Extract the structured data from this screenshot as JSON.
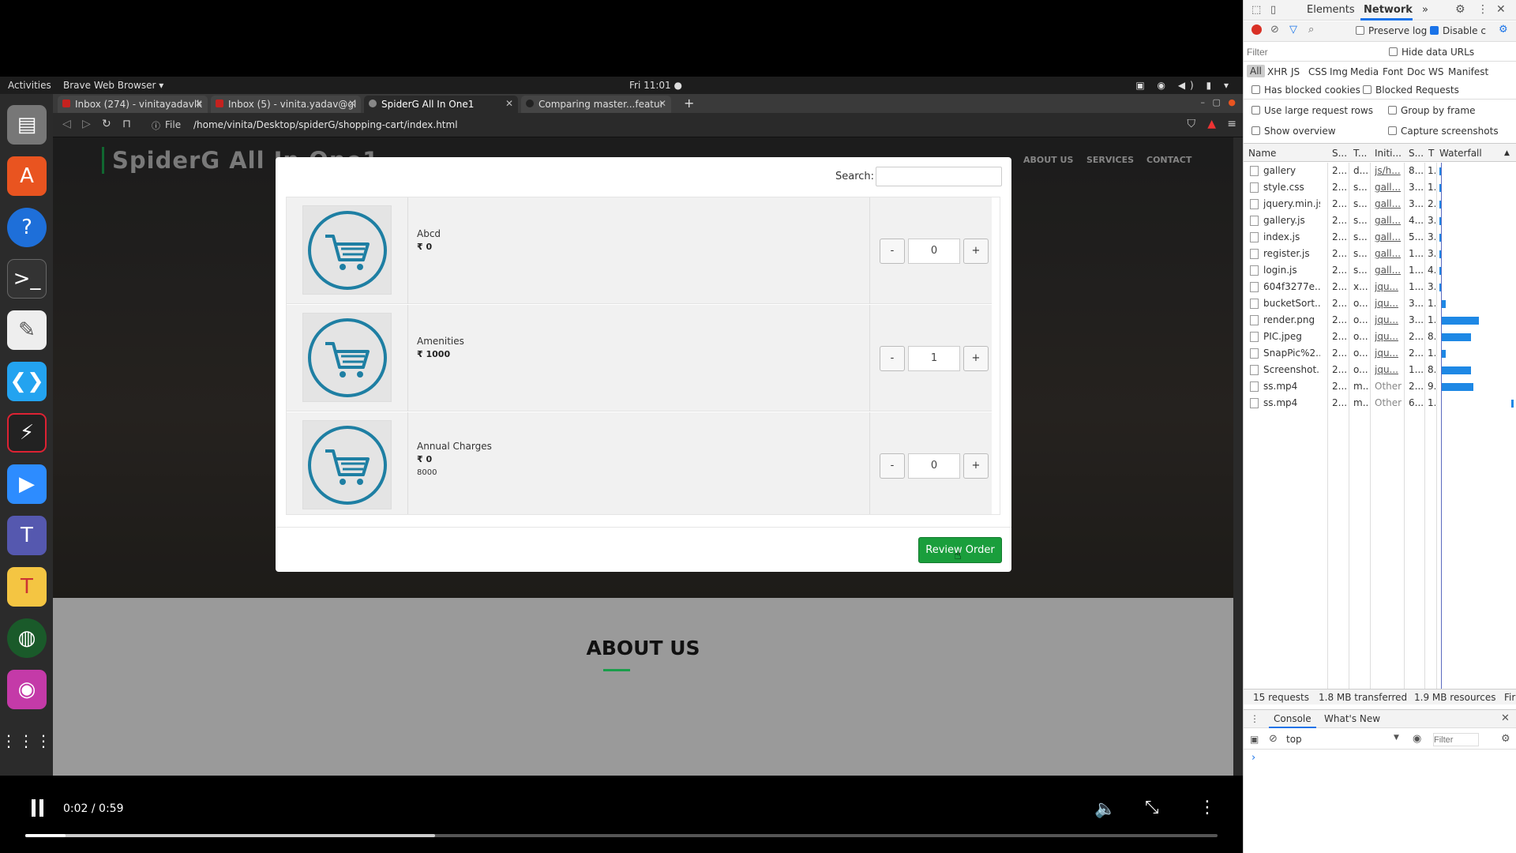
{
  "topbar": {
    "activities": "Activities",
    "app_menu": "Brave Web Browser ▾",
    "clock": "Fri 11:01 ●"
  },
  "browser": {
    "tabs": [
      {
        "label": "Inbox (274) - vinitayadavlk",
        "color": "#c5221f"
      },
      {
        "label": "Inbox (5) - vinita.yadav@gl",
        "color": "#c5221f"
      },
      {
        "label": "SpiderG All In One1",
        "color": "#888888"
      },
      {
        "label": "Comparing master...featur",
        "color": "#222222"
      }
    ],
    "new_tab": "+",
    "file_label": "File",
    "url": "/home/vinita/Desktop/spiderG/shopping-cart/index.html"
  },
  "site": {
    "logo": "SpiderG All In One1",
    "nav": [
      "ABOUT US",
      "SERVICES",
      "CONTACT"
    ],
    "about_title": "ABOUT US",
    "scroll_top": "^"
  },
  "modal": {
    "search_label": "Search:",
    "search_value": "",
    "currency": "₹",
    "items": [
      {
        "name": "Abcd",
        "price": "₹ 0",
        "extra": "",
        "qty": "0"
      },
      {
        "name": "Amenities",
        "price": "₹ 1000",
        "extra": "",
        "qty": "1"
      },
      {
        "name": "Annual Charges",
        "price": "₹ 0",
        "extra": "8000",
        "qty": "0"
      }
    ],
    "minus": "-",
    "plus": "+",
    "review_button": "Review Order"
  },
  "video": {
    "time": "0:02 / 0:59",
    "progress_fraction": 0.034,
    "buffered_fraction": 0.344
  },
  "devtools": {
    "tabs": [
      "Elements",
      "Network",
      "»"
    ],
    "active_tab": "Network",
    "preserve_log": "Preserve log",
    "disable_cache": "Disable c",
    "filter_placeholder": "Filter",
    "hide_data_urls": "Hide data URLs",
    "filter_types": [
      "All",
      "XHR",
      "JS",
      "CSS",
      "Img",
      "Media",
      "Font",
      "Doc",
      "WS",
      "Manifest"
    ],
    "has_blocked_cookies": "Has blocked cookies",
    "blocked_requests": "Blocked Requests",
    "use_large_rows": "Use large request rows",
    "group_by_frame": "Group by frame",
    "show_overview": "Show overview",
    "capture_screenshots": "Capture screenshots",
    "columns": [
      "Name",
      "S...",
      "T...",
      "Initi...",
      "S...",
      "T",
      "Waterfall"
    ],
    "rows": [
      {
        "name": "gallery",
        "s": "2...",
        "t": "d...",
        "init": "js/h...",
        "size": "8...",
        "time": "1.",
        "bar_start": 0.0,
        "bar_len": 0.02
      },
      {
        "name": "style.css",
        "s": "2...",
        "t": "s...",
        "init": "gall...",
        "size": "3...",
        "time": "1.",
        "bar_start": 0.0,
        "bar_len": 0.02
      },
      {
        "name": "jquery.min.js",
        "s": "2...",
        "t": "s...",
        "init": "gall...",
        "size": "3...",
        "time": "2.",
        "bar_start": 0.0,
        "bar_len": 0.02
      },
      {
        "name": "gallery.js",
        "s": "2...",
        "t": "s...",
        "init": "gall...",
        "size": "4...",
        "time": "3.",
        "bar_start": 0.0,
        "bar_len": 0.02
      },
      {
        "name": "index.js",
        "s": "2...",
        "t": "s...",
        "init": "gall...",
        "size": "5...",
        "time": "3.",
        "bar_start": 0.0,
        "bar_len": 0.02
      },
      {
        "name": "register.js",
        "s": "2...",
        "t": "s...",
        "init": "gall...",
        "size": "1...",
        "time": "3.",
        "bar_start": 0.0,
        "bar_len": 0.02
      },
      {
        "name": "login.js",
        "s": "2...",
        "t": "s...",
        "init": "gall...",
        "size": "1...",
        "time": "4.",
        "bar_start": 0.0,
        "bar_len": 0.02
      },
      {
        "name": "604f3277e...",
        "s": "2...",
        "t": "x...",
        "init": "jqu...",
        "size": "1...",
        "time": "3.",
        "bar_start": 0.0,
        "bar_len": 0.02
      },
      {
        "name": "bucketSort....",
        "s": "2...",
        "t": "o...",
        "init": "jqu...",
        "size": "3...",
        "time": "1.",
        "bar_start": 0.03,
        "bar_len": 0.05
      },
      {
        "name": "render.png",
        "s": "2...",
        "t": "o...",
        "init": "jqu...",
        "size": "3...",
        "time": "1.",
        "bar_start": 0.03,
        "bar_len": 0.5
      },
      {
        "name": "PIC.jpeg",
        "s": "2...",
        "t": "o...",
        "init": "jqu...",
        "size": "2...",
        "time": "8.",
        "bar_start": 0.03,
        "bar_len": 0.4
      },
      {
        "name": "SnapPic%2...",
        "s": "2...",
        "t": "o...",
        "init": "jqu...",
        "size": "2...",
        "time": "1.",
        "bar_start": 0.03,
        "bar_len": 0.05
      },
      {
        "name": "Screenshot...",
        "s": "2...",
        "t": "o...",
        "init": "jqu...",
        "size": "1...",
        "time": "8.",
        "bar_start": 0.03,
        "bar_len": 0.4
      },
      {
        "name": "ss.mp4",
        "s": "2...",
        "t": "m...",
        "init": "Other",
        "size": "2...",
        "time": "9.",
        "bar_start": 0.03,
        "bar_len": 0.43
      },
      {
        "name": "ss.mp4",
        "s": "2...",
        "t": "m...",
        "init": "Other",
        "size": "6...",
        "time": "1.",
        "bar_start": 0.97,
        "bar_len": 0.03
      }
    ],
    "status": {
      "requests": "15 requests",
      "transferred": "1.8 MB transferred",
      "resources": "1.9 MB resources",
      "finish": "Fir"
    },
    "drawer_tabs": [
      "Console",
      "What's New"
    ],
    "context": "top",
    "console_filter": "Filter",
    "prompt": "›"
  },
  "colors": {
    "accent_green": "#1a9e3c",
    "cart_blue": "#1e7fa3",
    "devtools_blue": "#1a73e8"
  }
}
